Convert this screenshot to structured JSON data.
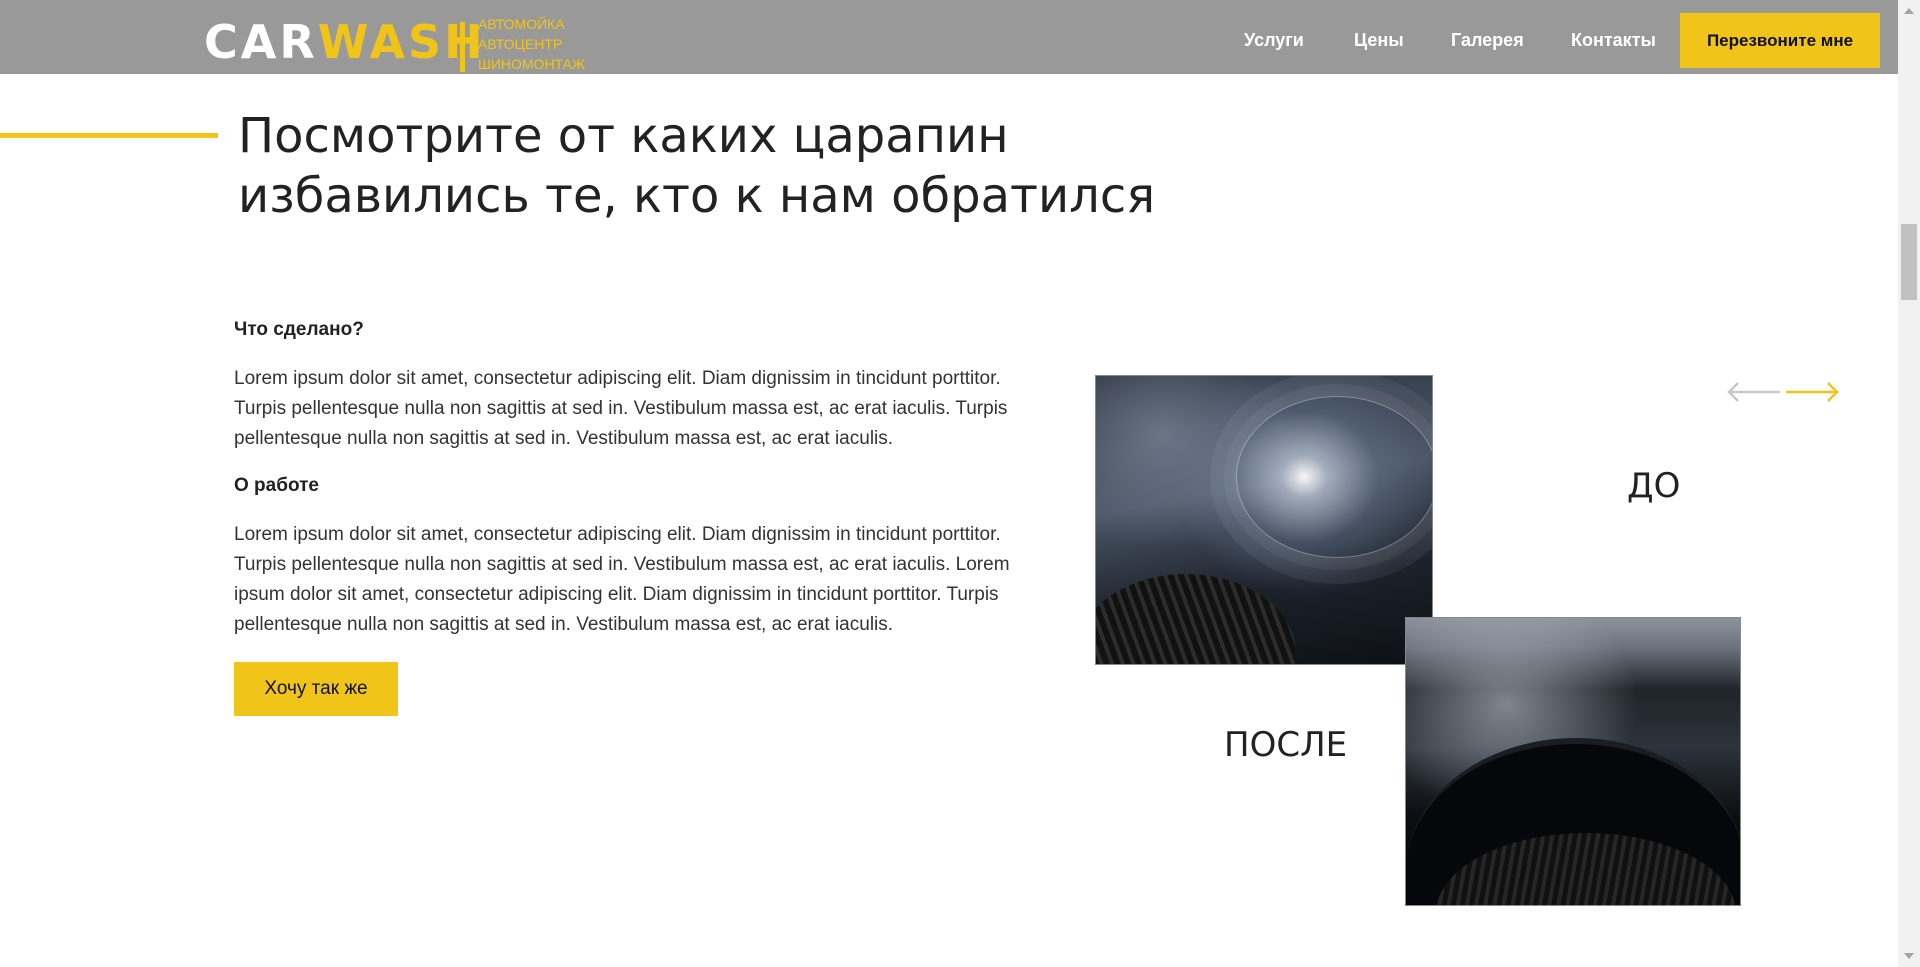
{
  "header": {
    "logo": {
      "part1": "CAR",
      "part2": "WASH"
    },
    "subtitle": [
      "АВТОМОЙКА",
      "АВТОЦЕНТР",
      "ШИНОМОНТАЖ"
    ],
    "nav": [
      "Услуги",
      "Цены",
      "Галерея",
      "Контакты"
    ],
    "callback_label": "Перезвоните мне"
  },
  "section": {
    "title_line1": "Посмотрите от каких царапин",
    "title_line2": "избавились те, кто к нам обратился",
    "heading1": "Что сделано?",
    "paragraph1": "Lorem ipsum dolor sit amet, consectetur adipiscing elit. Diam dignissim in tincidunt porttitor. Turpis pellentesque nulla non sagittis at sed in. Vestibulum massa est, ac erat iaculis. Turpis pellentesque nulla non sagittis at sed in. Vestibulum massa est, ac erat iaculis.",
    "heading2": "О работе",
    "paragraph2": "Lorem ipsum dolor sit amet, consectetur adipiscing elit. Diam dignissim in tincidunt porttitor. Turpis pellentesque nulla non sagittis at sed in. Vestibulum massa est, ac erat iaculis. Lorem ipsum dolor sit amet, consectetur adipiscing elit. Diam dignissim in tincidunt porttitor. Turpis pellentesque nulla non sagittis at sed in. Vestibulum massa est, ac erat iaculis.",
    "button_label": "Хочу так же"
  },
  "gallery": {
    "before_label": "ДО",
    "after_label": "ПОСЛЕ",
    "arrow_prev_icon": "arrow-left-icon",
    "arrow_next_icon": "arrow-right-icon"
  },
  "colors": {
    "accent": "#f0c419",
    "header_bg": "#999999",
    "arrow_inactive": "#c8c8c8"
  }
}
